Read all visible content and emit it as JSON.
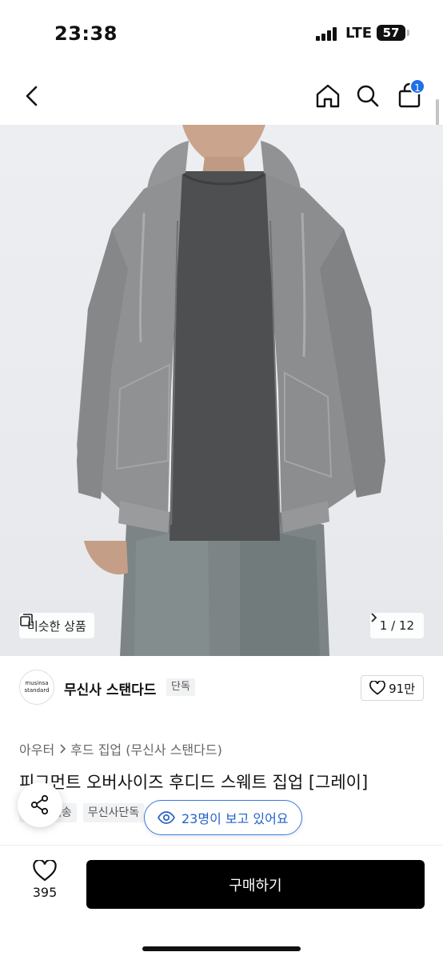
{
  "status_bar": {
    "time": "23:38",
    "network": "LTE",
    "battery": "57"
  },
  "nav": {
    "back_icon": "chevron-left-icon",
    "home_icon": "home-icon",
    "search_icon": "search-icon",
    "cart_icon": "shopping-bag-icon",
    "cart_badge": "1"
  },
  "hero": {
    "similar_label": "비슷한 상품",
    "page_indicator": "1 / 12"
  },
  "brand": {
    "logo_line1": "musinsa",
    "logo_line2": "standard",
    "name": "무신사 스탠다드",
    "tag": "단독",
    "like_count": "91만"
  },
  "product": {
    "breadcrumb": [
      "아우터",
      "후드 집업 (무신사 스탠다드)"
    ],
    "title": "피그먼트 오버사이즈 후디드 스웨트 집업 [그레이]",
    "tags": [
      "배송",
      "무신사단독"
    ],
    "viewing": "23명이 보고 있어요"
  },
  "bottom_bar": {
    "wish_count": "395",
    "buy_label": "구매하기"
  },
  "colors": {
    "accent": "#1e6fe8",
    "viewing_text": "#2461c7",
    "buy_button": "#000000"
  }
}
